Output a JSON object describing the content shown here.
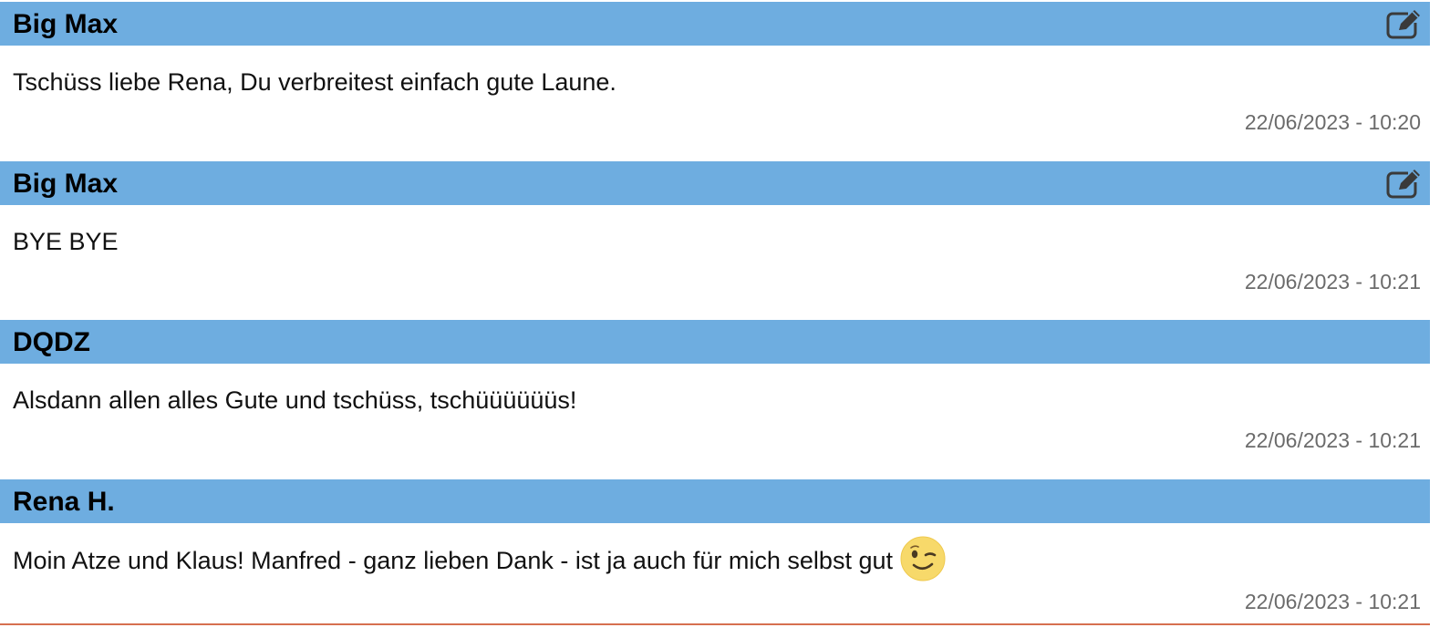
{
  "comments": [
    {
      "author": "Big Max",
      "text": "Tschüss liebe Rena, Du verbreitest einfach gute Laune.",
      "timestamp": "22/06/2023 - 10:20",
      "editable": true,
      "edit_icon": "edit-icon"
    },
    {
      "author": "Big Max",
      "text": "BYE BYE",
      "timestamp": "22/06/2023 - 10:21",
      "editable": true,
      "edit_icon": "edit-icon"
    },
    {
      "author": "DQDZ",
      "text": "Alsdann allen alles Gute und tschüss, tschüüüüüüs!",
      "timestamp": "22/06/2023 - 10:21",
      "editable": false
    },
    {
      "author": "Rena H.",
      "text": "Moin Atze und Klaus! Manfred - ganz lieben Dank - ist ja auch für mich selbst gut",
      "emoji": "winking-face",
      "timestamp": "22/06/2023 - 10:21",
      "editable": false
    }
  ],
  "colors": {
    "header_background": "#6eade0",
    "timestamp_text": "#6b6b6b",
    "bottom_rule": "#d6704f"
  }
}
